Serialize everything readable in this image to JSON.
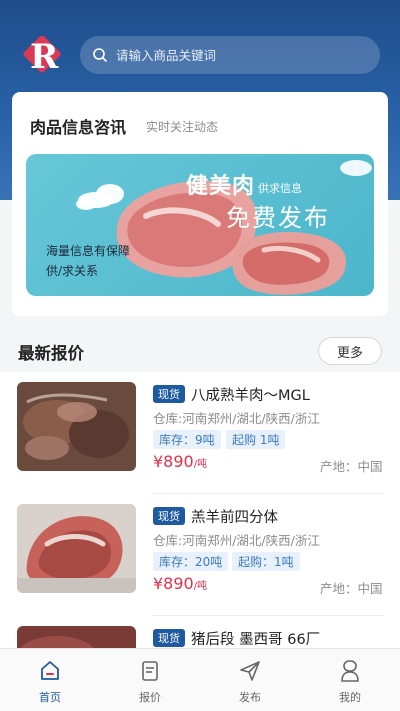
{
  "colors": {
    "brand_blue": "#1e4d8c",
    "badge_blue": "#1e5aa0",
    "price_red": "#e5304c",
    "tag_bg": "#e8f1fb",
    "tag_text": "#3c7bc2"
  },
  "header": {
    "logo_icon": "brand-r-logo",
    "search_icon": "search-icon",
    "search_placeholder": "请输入商品关键词"
  },
  "info_card": {
    "title": "肉品信息咨讯",
    "subtitle": "实时关注动态",
    "banner": {
      "title": "健美肉",
      "supply": "供求信息",
      "free": "免费发布",
      "line1": "海量信息有保障",
      "line2": "供/求关系"
    }
  },
  "latest": {
    "title": "最新报价",
    "more_label": "更多",
    "items": [
      {
        "badge": "现货",
        "name": "八成熟羊肉～MGL",
        "warehouse": "仓库:河南郑州/湖北/陕西/浙江",
        "stock": "库存：9吨",
        "min_order": "起购  1吨",
        "price": "¥890",
        "unit": "/吨",
        "origin": "产地：中国"
      },
      {
        "badge": "现货",
        "name": "羔羊前四分体",
        "warehouse": "仓库:河南郑州/湖北/陕西/浙江",
        "stock": "库存：20吨",
        "min_order": "起购：1吨",
        "price": "¥890",
        "unit": "/吨",
        "origin": "产地：中国"
      },
      {
        "badge": "现货",
        "name": "猪后段 墨西哥 66厂",
        "warehouse": "",
        "stock": "",
        "min_order": "",
        "price": "",
        "unit": "",
        "origin": ""
      }
    ]
  },
  "tabbar": {
    "items": [
      {
        "label": "首页",
        "icon": "home-icon",
        "active": true
      },
      {
        "label": "报价",
        "icon": "quote-icon",
        "active": false
      },
      {
        "label": "发布",
        "icon": "send-icon",
        "active": false
      },
      {
        "label": "我的",
        "icon": "user-icon",
        "active": false
      }
    ]
  }
}
